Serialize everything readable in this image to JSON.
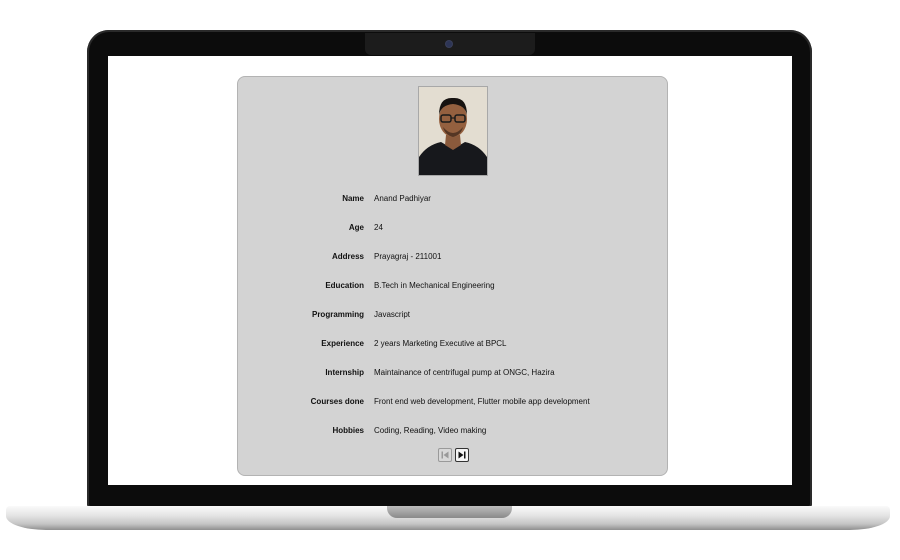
{
  "profile": {
    "fields": [
      {
        "label": "Name",
        "value": "Anand Padhiyar"
      },
      {
        "label": "Age",
        "value": "24"
      },
      {
        "label": "Address",
        "value": "Prayagraj - 211001"
      },
      {
        "label": "Education",
        "value": "B.Tech in Mechanical Engineering"
      },
      {
        "label": "Programming",
        "value": "Javascript"
      },
      {
        "label": "Experience",
        "value": "2 years Marketing Executive at BPCL"
      },
      {
        "label": "Internship",
        "value": "Maintainance of centrifugal pump at ONGC, Hazira"
      },
      {
        "label": "Courses done",
        "value": "Front end web development, Flutter mobile app development"
      },
      {
        "label": "Hobbies",
        "value": "Coding, Reading, Video making"
      }
    ]
  },
  "pager": {
    "prev_icon": "skip-previous-icon",
    "next_icon": "skip-next-icon",
    "prev_enabled": false,
    "next_enabled": true
  },
  "colors": {
    "card_background": "#d3d3d3",
    "bezel": "#0c0c0c",
    "screen": "#ffffff"
  }
}
